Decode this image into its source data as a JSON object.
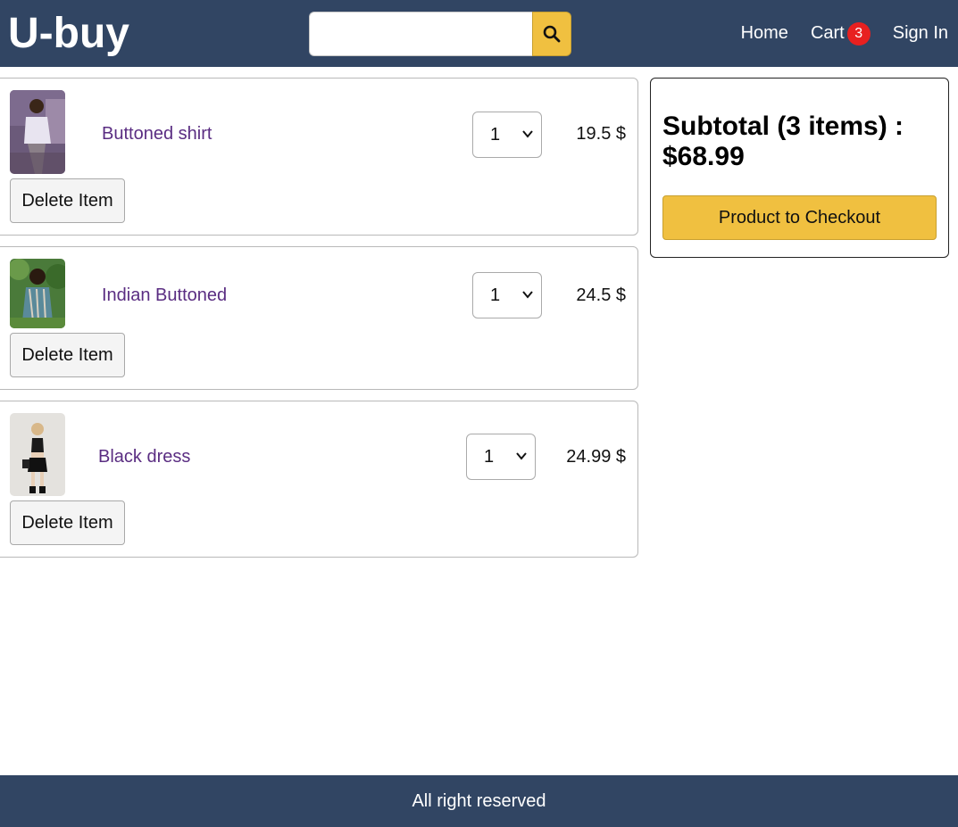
{
  "header": {
    "brand": "U-buy",
    "search": {
      "value": "",
      "placeholder": "",
      "button_icon": "search-icon"
    },
    "nav": {
      "home": "Home",
      "cart": "Cart",
      "cart_count": "3",
      "signin": "Sign In"
    }
  },
  "cart": {
    "items": [
      {
        "name": "Buttoned shirt",
        "qty": "1",
        "price": "19.5 $",
        "delete_label": "Delete Item",
        "image": "product-image-buttoned-shirt"
      },
      {
        "name": "Indian Buttoned",
        "qty": "1",
        "price": "24.5 $",
        "delete_label": "Delete Item",
        "image": "product-image-indian-buttoned"
      },
      {
        "name": "Black dress",
        "qty": "1",
        "price": "24.99 $",
        "delete_label": "Delete Item",
        "image": "product-image-black-dress"
      }
    ]
  },
  "summary": {
    "subtotal_label": "Subtotal (3 items) :",
    "subtotal_value": "$68.99",
    "checkout_label": "Product to Checkout"
  },
  "footer": {
    "text": "All right reserved"
  },
  "colors": {
    "header_bg": "#314563",
    "accent": "#f0c040",
    "link": "#5a2d82",
    "badge": "#e82020"
  }
}
